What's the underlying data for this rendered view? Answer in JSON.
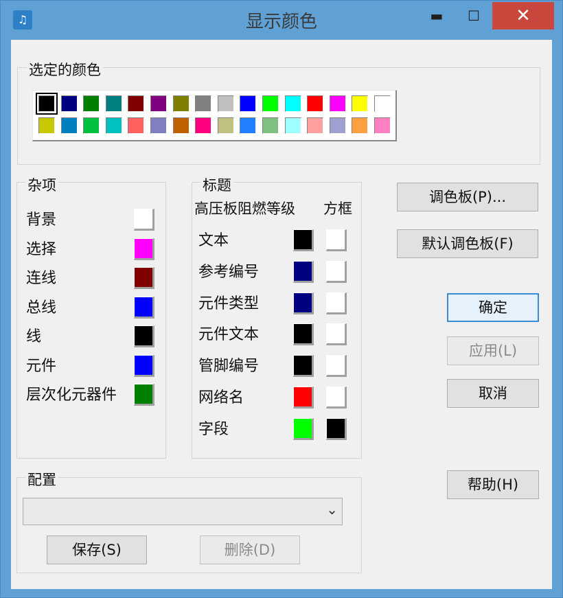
{
  "window": {
    "title": "显示颜色",
    "minimize_glyph": "▬",
    "maximize_glyph": "☐",
    "close_glyph": "✕",
    "app_icon_glyph": "♫"
  },
  "selected_colors": {
    "label": "选定的颜色",
    "row1": [
      "#000000",
      "#000080",
      "#008000",
      "#008080",
      "#800000",
      "#800080",
      "#808000",
      "#808080",
      "#c0c0c0",
      "#0000ff",
      "#00ff00",
      "#00ffff",
      "#ff0000",
      "#ff00ff",
      "#ffff00",
      "#ffffff"
    ],
    "row2": [
      "#c8c800",
      "#0080c0",
      "#00c040",
      "#00c0c0",
      "#ff6060",
      "#8080c0",
      "#c06000",
      "#ff0080",
      "#c0c080",
      "#2080ff",
      "#80c080",
      "#a0ffff",
      "#ffa0a0",
      "#a0a0d0",
      "#ffa040",
      "#ff80c0"
    ]
  },
  "misc": {
    "label": "杂项",
    "items": [
      {
        "label": "背景",
        "color": "#ffffff"
      },
      {
        "label": "选择",
        "color": "#ff00ff"
      },
      {
        "label": "连线",
        "color": "#800000"
      },
      {
        "label": "总线",
        "color": "#0000ff"
      },
      {
        "label": "线",
        "color": "#000000"
      },
      {
        "label": "元件",
        "color": "#0000ff"
      },
      {
        "label": "层次化元器件",
        "color": "#008000"
      }
    ]
  },
  "titles": {
    "label": "标题",
    "header_left": "高压板阻燃等级",
    "header_right": "方框",
    "items": [
      {
        "label": "文本",
        "color": "#000000",
        "box": "#ffffff"
      },
      {
        "label": "参考编号",
        "color": "#000080",
        "box": "#ffffff"
      },
      {
        "label": "元件类型",
        "color": "#000080",
        "box": "#ffffff"
      },
      {
        "label": "元件文本",
        "color": "#000000",
        "box": "#ffffff"
      },
      {
        "label": "管脚编号",
        "color": "#000000",
        "box": "#ffffff"
      },
      {
        "label": "网络名",
        "color": "#ff0000",
        "box": "#ffffff"
      },
      {
        "label": "字段",
        "color": "#00ff00",
        "box": "#000000"
      }
    ]
  },
  "buttons": {
    "palette": "调色板(P)...",
    "default_palette": "默认调色板(F)",
    "ok": "确定",
    "apply": "应用(L)",
    "cancel": "取消",
    "help": "帮助(H)"
  },
  "config": {
    "label": "配置",
    "selected_value": "",
    "dropdown_glyph": "⌄",
    "save": "保存(S)",
    "delete": "删除(D)"
  }
}
